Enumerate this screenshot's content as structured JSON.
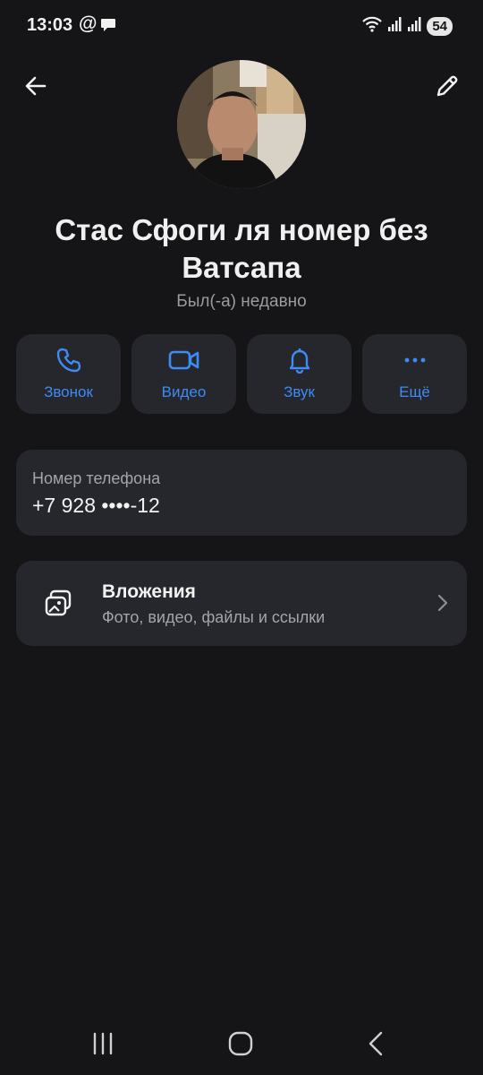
{
  "status_bar": {
    "time": "13:03",
    "at_symbol": "@",
    "battery": "54",
    "icons": [
      "chat-bubble-icon",
      "wifi-icon",
      "signal-icon",
      "signal-icon"
    ]
  },
  "header": {
    "back_icon": "arrow-left-icon",
    "edit_icon": "pencil-icon"
  },
  "contact": {
    "name": "Стас Сфоги ля номер без Ватсапа",
    "status": "Был(-а) недавно"
  },
  "actions": [
    {
      "label": "Звонок",
      "icon": "phone-icon"
    },
    {
      "label": "Видео",
      "icon": "video-icon"
    },
    {
      "label": "Звук",
      "icon": "bell-icon"
    },
    {
      "label": "Ещё",
      "icon": "more-icon"
    }
  ],
  "phone": {
    "label": "Номер телефона",
    "value": "+7 928 ••••-12"
  },
  "attachments": {
    "title": "Вложения",
    "subtitle": "Фото, видео, файлы и ссылки"
  },
  "colors": {
    "background": "#151518",
    "card": "#26272c",
    "accent": "#3d8bf5",
    "muted_text": "#a4a4aa"
  }
}
